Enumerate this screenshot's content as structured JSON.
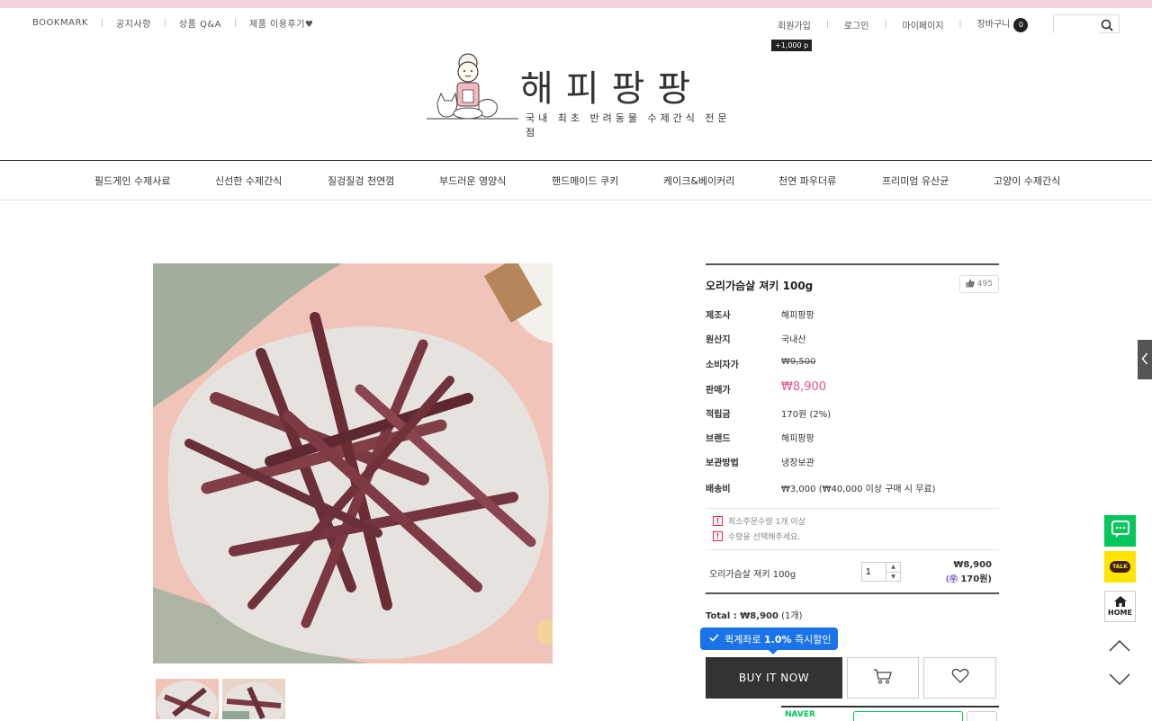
{
  "top_nav": {
    "items": [
      "BOOKMARK",
      "공지사항",
      "상품 Q&A",
      "제품 이용후기♥"
    ]
  },
  "user_links": {
    "signup": "회원가입",
    "login": "로그인",
    "mypage": "마이페이지",
    "cart": "장바구니",
    "cart_count": "0",
    "signup_point": "+1,000 p"
  },
  "search": {
    "placeholder": ""
  },
  "logo": {
    "title": "해피팡팡",
    "subtitle": "국내 최초 반려동물 수제간식 전문점"
  },
  "categories": [
    "필드게인 수제사료",
    "신선한 수제간식",
    "질겅질겅 천연껌",
    "부드러운 영양식",
    "핸드메이드 쿠키",
    "케이크&베이커리",
    "천연 파우더류",
    "프리미엄 유산균",
    "고양이 수제간식"
  ],
  "product": {
    "name": "오리가슴살 져키 100g",
    "likes": "495",
    "details": [
      {
        "label": "제조사",
        "value": "해피팡팡"
      },
      {
        "label": "원산지",
        "value": "국내산"
      },
      {
        "label": "소비자가",
        "value": "₩9,500"
      },
      {
        "label": "판매가",
        "value": "₩8,900"
      },
      {
        "label": "적립금",
        "value": "170원 (2%)"
      },
      {
        "label": "브랜드",
        "value": "해피팡팡"
      },
      {
        "label": "보관방법",
        "value": "냉장보관"
      },
      {
        "label": "배송비",
        "value": "₩3,000 (₩40,000 이상 구매 시 무료)"
      }
    ],
    "notices": [
      "최소주문수량 1개 이상",
      "수량을 선택해주세요."
    ],
    "option": {
      "name": "오리가슴살 져키 100g",
      "quantity": "1",
      "price": "₩8,900",
      "points": "170원)"
    },
    "total_label": "Total : ",
    "total_price": "₩8,900",
    "total_count": "(1개)",
    "promo_prefix": "퀵계좌로 ",
    "promo_rate": "1.0%",
    "promo_suffix": " 즉시할인",
    "buy_now": "BUY IT NOW",
    "naver_pay": "NAVER"
  },
  "quick_menu": {
    "talk": "TALK",
    "home": "HOME"
  },
  "colors": {
    "accent_pink": "#e6528f",
    "top_bar": "#f2d3dc",
    "promo_blue": "#1a73e8",
    "naver_green": "#03c75a",
    "kakao_yellow": "#fee500"
  }
}
